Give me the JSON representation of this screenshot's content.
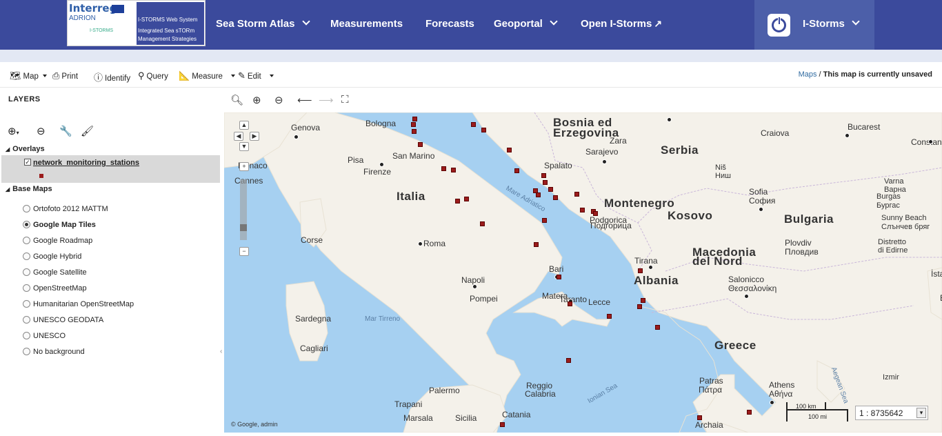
{
  "logo": {
    "brand": "Interreg",
    "program": "ADRION",
    "project": "I-STORMS",
    "system_title": "I-STORMS Web System",
    "subtitle": "Integrated Sea sTORm Management Strategies"
  },
  "nav": {
    "items": [
      {
        "label": "Sea Storm Atlas"
      },
      {
        "label": "Measurements"
      },
      {
        "label": "Forecasts"
      },
      {
        "label": "Geoportal"
      },
      {
        "label": "Open I-Storms"
      }
    ],
    "user": "I-Storms"
  },
  "toolbar": {
    "map": "Map",
    "print": "Print",
    "identify": "Identify",
    "query": "Query",
    "measure": "Measure",
    "edit": "Edit",
    "breadcrumb_link": "Maps",
    "breadcrumb_sep": " / ",
    "breadcrumb_current": "This map is currently unsaved"
  },
  "layers": {
    "title": "LAYERS",
    "overlays_label": "Overlays",
    "overlay_layer": "network_monitoring_stations",
    "basemaps_label": "Base Maps",
    "basemaps": [
      {
        "label": "Ortofoto 2012 MATTM"
      },
      {
        "label": "Google Map Tiles",
        "selected": true
      },
      {
        "label": "Google Roadmap"
      },
      {
        "label": "Google Hybrid"
      },
      {
        "label": "Google Satellite"
      },
      {
        "label": "OpenStreetMap"
      },
      {
        "label": "Humanitarian OpenStreetMap"
      },
      {
        "label": "UNESCO GEODATA"
      },
      {
        "label": "UNESCO"
      },
      {
        "label": "No background"
      }
    ]
  },
  "map": {
    "countries": [
      "Bosnia ed",
      "Erzegovina",
      "Serbia",
      "Italia",
      "Montenegro",
      "Kosovo",
      "Bulgaria",
      "Albania",
      "Macedonia",
      "del Nord",
      "Greece"
    ],
    "cities": [
      "Genova",
      "Bologna",
      "San Marino",
      "Firenze",
      "Pisa",
      "Roma",
      "Napoli",
      "Pompei",
      "Bari",
      "Taranto",
      "Lecce",
      "Matera",
      "Sarajevo",
      "Zara",
      "Spalato",
      "Podgorica",
      "Подгорица",
      "Tirana",
      "Sofia",
      "София",
      "Plovdiv",
      "Пловдив",
      "Salonicco",
      "Θεσσαλονίκη",
      "Athens",
      "Αθήνα",
      "Patras",
      "Πάτρα",
      "Bucarest",
      "Craiova",
      "Niš",
      "Ниш",
      "Varna",
      "Варна",
      "Burgas",
      "Бургас",
      "Sunny Beach",
      "Слънчев бряг",
      "Distretto",
      "di Edirne",
      "Izmir",
      "Palermo",
      "Catania",
      "Reggio",
      "Calabria",
      "Trapani",
      "Marsala",
      "Sicilia",
      "Sardegna",
      "Cagliari",
      "Corse",
      "Cannes",
      "Monaco",
      "Constanta",
      "İstan",
      "Бур",
      "Archaia"
    ],
    "seas": [
      "Mare Adriatico",
      "Mar Tirreno",
      "Ionian Sea",
      "Aegean Sea"
    ],
    "attribution": "© Google, admin",
    "scale_km": "100 km",
    "scale_mi": "100 mi",
    "scale_ratio": "1 : 8735642"
  },
  "colors": {
    "nav_bg": "#3b4a9c",
    "station": "#9b1c1c",
    "sea": "#a6d0f1",
    "land": "#f4f1ea"
  }
}
